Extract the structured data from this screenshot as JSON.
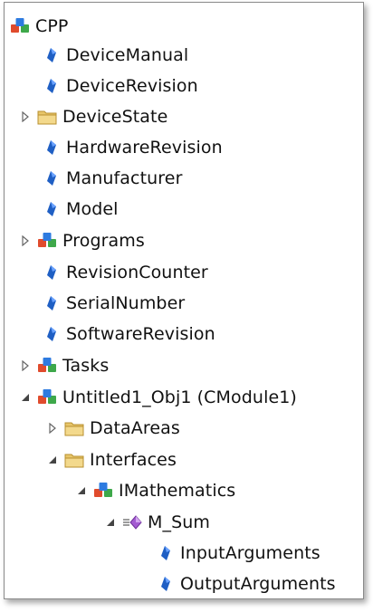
{
  "tree": {
    "root": {
      "label": "CPP",
      "icon": "object-type-icon"
    },
    "items": [
      {
        "label": "DeviceManual",
        "icon": "property-icon"
      },
      {
        "label": "DeviceRevision",
        "icon": "property-icon"
      },
      {
        "label": "DeviceState",
        "icon": "folder-icon",
        "expanded": false
      },
      {
        "label": "HardwareRevision",
        "icon": "property-icon"
      },
      {
        "label": "Manufacturer",
        "icon": "property-icon"
      },
      {
        "label": "Model",
        "icon": "property-icon"
      },
      {
        "label": "Programs",
        "icon": "object-type-icon",
        "expanded": false
      },
      {
        "label": "RevisionCounter",
        "icon": "property-icon"
      },
      {
        "label": "SerialNumber",
        "icon": "property-icon"
      },
      {
        "label": "SoftwareRevision",
        "icon": "property-icon"
      },
      {
        "label": "Tasks",
        "icon": "object-type-icon",
        "expanded": false
      },
      {
        "label": "Untitled1_Obj1 (CModule1)",
        "icon": "object-type-icon",
        "expanded": true
      },
      {
        "label": "DataAreas",
        "icon": "folder-icon",
        "expanded": false
      },
      {
        "label": "Interfaces",
        "icon": "folder-icon",
        "expanded": true
      },
      {
        "label": "IMathematics",
        "icon": "object-type-icon",
        "expanded": true
      },
      {
        "label": "M_Sum",
        "icon": "method-icon",
        "expanded": true
      },
      {
        "label": "InputArguments",
        "icon": "property-icon"
      },
      {
        "label": "OutputArguments",
        "icon": "property-icon"
      }
    ]
  },
  "colors": {
    "text": "#111111",
    "property_blue": "#1f5fc4",
    "folder_yellow": "#e8c66a",
    "method_purple": "#a35bd1",
    "cube_red": "#e04b2d",
    "cube_green": "#3ea84a",
    "cube_blue": "#2e7be0"
  }
}
